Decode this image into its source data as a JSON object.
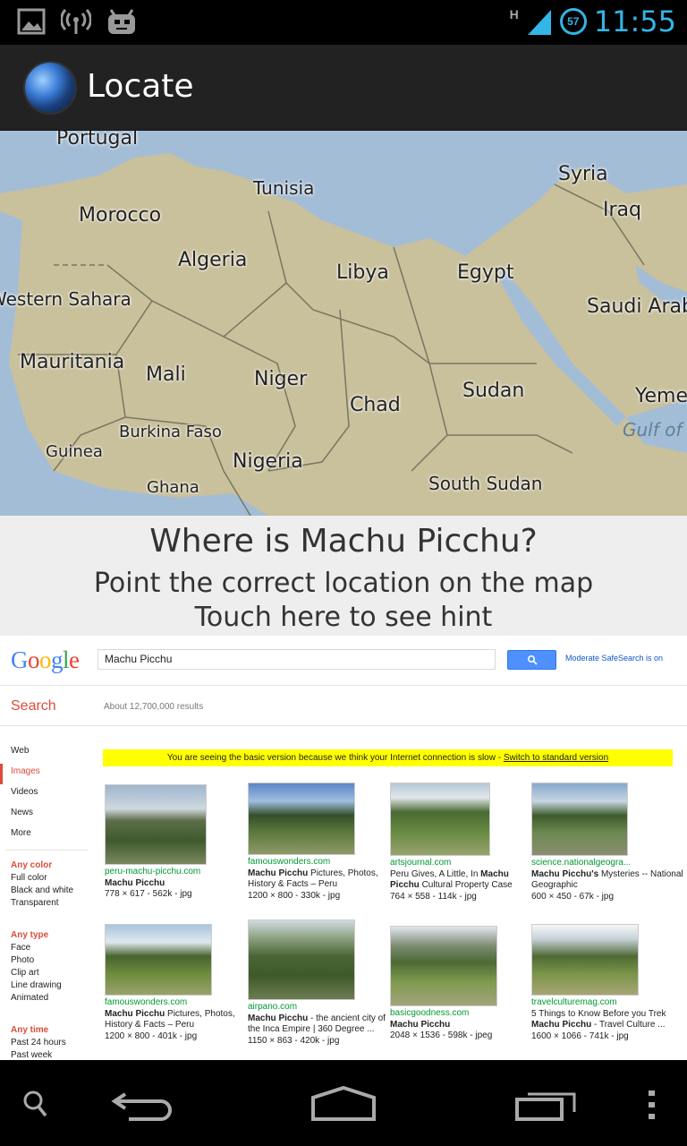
{
  "status_bar": {
    "time": "11:55",
    "battery_level": "57",
    "network_type": "H",
    "icons": [
      "picture-icon",
      "wireless-icon",
      "android-debug-icon",
      "signal-icon",
      "battery-icon"
    ]
  },
  "action_bar": {
    "title": "Locate",
    "icon": "globe-icon"
  },
  "map": {
    "labels": [
      {
        "id": "portugal",
        "text": "Portugal"
      },
      {
        "id": "tunisia",
        "text": "Tunisia"
      },
      {
        "id": "syria",
        "text": "Syria"
      },
      {
        "id": "morocco",
        "text": "Morocco"
      },
      {
        "id": "iraq",
        "text": "Iraq"
      },
      {
        "id": "algeria",
        "text": "Algeria"
      },
      {
        "id": "libya",
        "text": "Libya"
      },
      {
        "id": "egypt",
        "text": "Egypt"
      },
      {
        "id": "western_sahara",
        "text": "Western Sahara"
      },
      {
        "id": "saudi_arabia",
        "text": "Saudi Arabi"
      },
      {
        "id": "mauritania",
        "text": "Mauritania"
      },
      {
        "id": "mali",
        "text": "Mali"
      },
      {
        "id": "niger",
        "text": "Niger"
      },
      {
        "id": "sudan",
        "text": "Sudan"
      },
      {
        "id": "yemen",
        "text": "Yeme"
      },
      {
        "id": "chad",
        "text": "Chad"
      },
      {
        "id": "gulf_of_aden",
        "text": "Gulf of A"
      },
      {
        "id": "burkina_faso",
        "text": "Burkina Faso"
      },
      {
        "id": "guinea",
        "text": "Guinea"
      },
      {
        "id": "nigeria",
        "text": "Nigeria"
      },
      {
        "id": "ghana",
        "text": "Ghana"
      },
      {
        "id": "south_sudan",
        "text": "South Sudan"
      }
    ],
    "colors": {
      "land": "#c9c09c",
      "water": "#a4bdd6"
    }
  },
  "question": {
    "title": "Where is Machu Picchu?",
    "instruction": "Point the correct location on the map",
    "hint": "Touch here to see hint"
  },
  "google": {
    "logo": "Google",
    "query": "Machu Picchu",
    "safesearch": "Moderate SafeSearch is on",
    "search_tab": "Search",
    "result_count": "About 12,700,000 results",
    "nav": [
      {
        "label": "Web",
        "active": false
      },
      {
        "label": "Images",
        "active": true
      },
      {
        "label": "Videos",
        "active": false
      },
      {
        "label": "News",
        "active": false
      },
      {
        "label": "More",
        "active": false
      }
    ],
    "color_filter": {
      "title": "Any color",
      "items": [
        "Full color",
        "Black and white",
        "Transparent"
      ]
    },
    "type_filter": {
      "title": "Any type",
      "items": [
        "Face",
        "Photo",
        "Clip art",
        "Line drawing",
        "Animated"
      ]
    },
    "time_filter": {
      "title": "Any time",
      "items": [
        "Past 24 hours",
        "Past week"
      ]
    },
    "notice": {
      "text": "You are seeing the basic version because we think your Internet connection is slow - ",
      "link": "Switch to standard version"
    },
    "results": [
      {
        "domain": "peru-machu-picchu.com",
        "title_bold": "Machu Picchu",
        "title_rest": "",
        "meta": "778 × 617 - 562k - jpg"
      },
      {
        "domain": "famouswonders.com",
        "title_bold": "Machu Picchu",
        "title_rest": " Pictures, Photos, History & Facts – Peru",
        "meta": "1200 × 800 - 330k - jpg"
      },
      {
        "domain": "artsjournal.com",
        "title_pre": "Peru Gives, A Little, In ",
        "title_bold": "Machu Picchu",
        "title_rest": " Cultural Property Case",
        "meta": "764 × 558 - 114k - jpg"
      },
      {
        "domain": "science.nationalgeogra...",
        "title_bold": "Machu Picchu's",
        "title_rest": " Mysteries -- National Geographic",
        "meta": "600 × 450 - 67k - jpg"
      },
      {
        "domain": "famouswonders.com",
        "title_bold": "Machu Picchu",
        "title_rest": " Pictures, Photos, History & Facts – Peru",
        "meta": "1200 × 800 - 401k - jpg"
      },
      {
        "domain": "airpano.com",
        "title_bold": "Machu Picchu",
        "title_rest": " - the ancient city of the Inca Empire | 360 Degree ...",
        "meta": "1150 × 863 - 420k - jpg"
      },
      {
        "domain": "basicgoodness.com",
        "title_bold": "Machu Picchu",
        "title_rest": "",
        "meta": "2048 × 1536 - 598k - jpeg"
      },
      {
        "domain": "travelculturemag.com",
        "title_pre": "5 Things to Know Before you Trek ",
        "title_bold": "Machu Picchu",
        "title_rest": " - Travel Culture ...",
        "meta": "1600 × 1066 - 741k - jpg"
      }
    ]
  },
  "nav_bar": {
    "icons": [
      "search-icon",
      "back-icon",
      "home-icon",
      "recent-apps-icon",
      "menu-icon"
    ]
  }
}
